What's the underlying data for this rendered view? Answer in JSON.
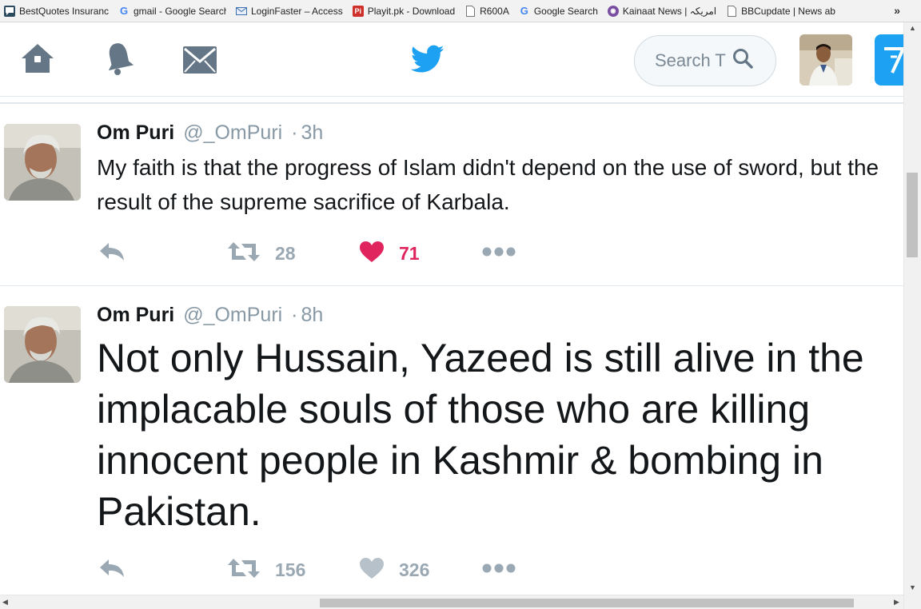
{
  "bookmarks": [
    {
      "label": "BestQuotes Insurance",
      "icon": "chat-icon",
      "color": "#2c4a5e"
    },
    {
      "label": "gmail - Google Search",
      "icon": "google-icon",
      "color": "#4285f4"
    },
    {
      "label": "LoginFaster – Access",
      "icon": "envelope-icon",
      "color": "#3a6fb0"
    },
    {
      "label": "Playit.pk - Download",
      "icon": "pi-icon",
      "color": "#d0302a"
    },
    {
      "label": "R600A",
      "icon": "page-icon",
      "color": "#ffffff"
    },
    {
      "label": "Google Search",
      "icon": "google-icon",
      "color": "#4285f4"
    },
    {
      "label": "Kainaat News | امریکہ",
      "icon": "globe-icon",
      "color": "#7a4ea0"
    },
    {
      "label": "BBCupdate | News ab",
      "icon": "page-icon",
      "color": "#ffffff"
    }
  ],
  "bookmarks_more": "»",
  "header": {
    "nav": [
      "home-icon",
      "bell-icon",
      "mail-icon"
    ],
    "logo": "twitter-bird-icon",
    "search_text": "Search T",
    "brand_color": "#1da1f2",
    "icon_color": "#657786"
  },
  "tweets": [
    {
      "name": "Om Puri",
      "handle": "@_OmPuri",
      "sep": "·",
      "time": "3h",
      "text": "My faith is that the progress of Islam didn't depend on the use of sword, but the result of the supreme sacrifice of Karbala.",
      "retweets": "28",
      "likes": "71",
      "liked": true
    },
    {
      "name": "Om Puri",
      "handle": "@_OmPuri",
      "sep": "·",
      "time": "8h",
      "text": "Not only Hussain, Yazeed is still alive in the implacable souls of those who are killing innocent people in Kashmir & bombing in Pakistan.",
      "retweets": "156",
      "likes": "326",
      "liked": false
    }
  ],
  "colors": {
    "like_active": "#e0245e",
    "action_gray": "#9aa8b3",
    "text": "#14171a"
  }
}
